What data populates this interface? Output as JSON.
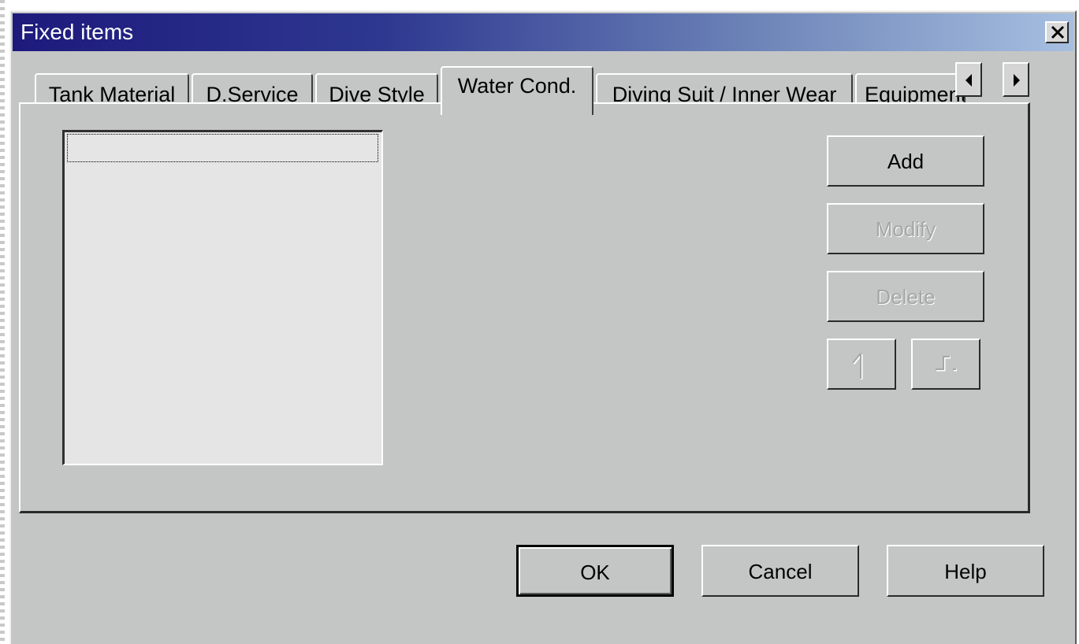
{
  "window": {
    "title": "Fixed items"
  },
  "tabs": [
    {
      "label": "Tank Material"
    },
    {
      "label": "D.Service"
    },
    {
      "label": "Dive Style"
    },
    {
      "label": "Water Cond."
    },
    {
      "label": "Diving Suit / Inner Wear"
    },
    {
      "label": "Equipment"
    }
  ],
  "active_tab": "Water Cond.",
  "list": {
    "items": [
      ""
    ]
  },
  "actions": {
    "add": "Add",
    "modify": "Modify",
    "delete": "Delete",
    "move_up_icon": "move-up-icon",
    "move_down_icon": "move-down-icon"
  },
  "footer": {
    "ok": "OK",
    "cancel": "Cancel",
    "help": "Help"
  },
  "colors": {
    "titlebar_start": "#1d1a7c",
    "titlebar_end": "#a7bfe0",
    "face": "#c4c6c6",
    "disabled_text": "#a6a6a6"
  }
}
